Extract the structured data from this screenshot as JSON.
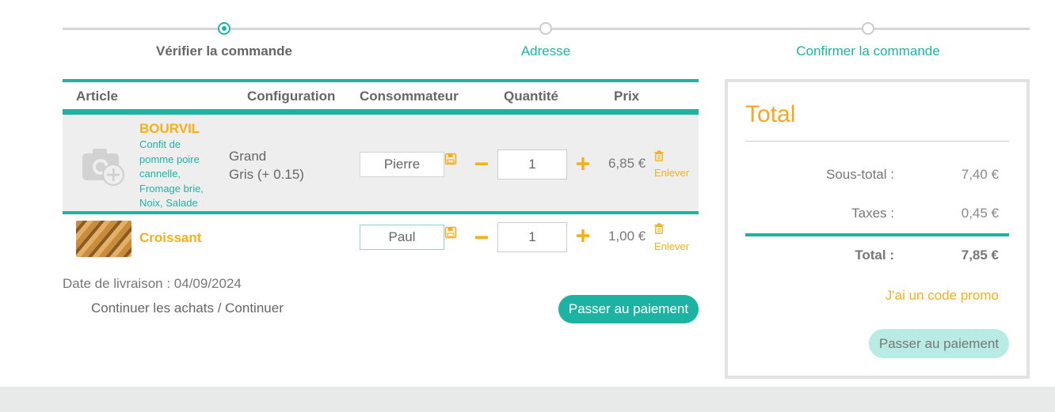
{
  "stepper": {
    "steps": [
      {
        "label": "Vérifier la commande",
        "active": true
      },
      {
        "label": "Adresse",
        "active": false
      },
      {
        "label": "Confirmer la commande",
        "active": false
      }
    ]
  },
  "table": {
    "headers": {
      "article": "Article",
      "configuration": "Configuration",
      "consumer": "Consommateur",
      "quantity": "Quantité",
      "price": "Prix"
    },
    "rows": [
      {
        "name": "BOURVIL",
        "description": "Confit de pomme poire cannelle, Fromage brie, Noix, Salade",
        "configuration": [
          "Grand",
          "Gris (+ 0.15)"
        ],
        "consumer": "Pierre",
        "quantity": "1",
        "price": "6,85 €",
        "remove_label": "Enlever",
        "image_icon": "camera-add-icon"
      },
      {
        "name": "Croissant",
        "description": "",
        "configuration": [],
        "consumer": "Paul",
        "quantity": "1",
        "price": "1,00 €",
        "remove_label": "Enlever",
        "image_icon": "croissant-photo"
      }
    ]
  },
  "delivery": {
    "label": "Date de livraison : 04/09/2024"
  },
  "continue_label": "Continuer les achats / Continuer",
  "pay_button_label": "Passer au paiement",
  "summary": {
    "title": "Total",
    "subtotal_label": "Sous-total :",
    "subtotal_value": "7,40 €",
    "taxes_label": "Taxes :",
    "taxes_value": "0,45 €",
    "total_label": "Total :",
    "total_value": "7,85 €",
    "promo_label": "J'ai un code promo",
    "pay_button_label": "Passer au paiement"
  },
  "colors": {
    "accent": "#1db3a3",
    "highlight": "#f5b017",
    "summary_title": "#f5a623",
    "disabled_button": "#b9ebe5"
  }
}
